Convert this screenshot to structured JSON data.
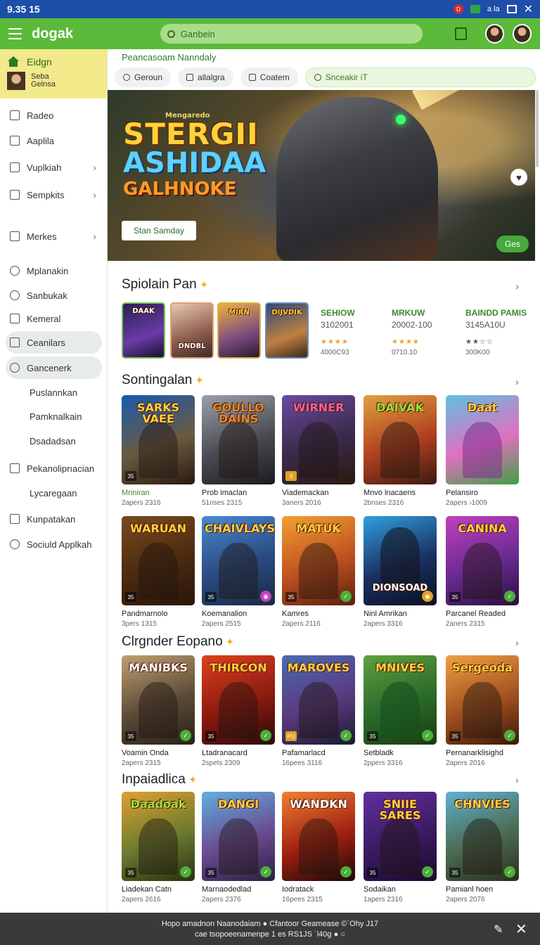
{
  "status": {
    "time": "9.35 15",
    "tray_text": "a la"
  },
  "appbar": {
    "brand": "dogak",
    "search_placeholder": "Ganbein"
  },
  "sidebar": {
    "home_label": "Eidgn",
    "user_name_1": "Seba",
    "user_name_2": "Gelnsa",
    "items": [
      {
        "label": "Radeo",
        "chev": ""
      },
      {
        "label": "Aaplila",
        "chev": ""
      },
      {
        "label": "Vuplkiah",
        "chev": "›"
      },
      {
        "label": "Sempkits",
        "chev": "›"
      },
      {
        "label": "Merkes",
        "chev": "›"
      },
      {
        "label": "Mplanakin",
        "chev": ""
      },
      {
        "label": "Sanbukak",
        "chev": ""
      },
      {
        "label": "Kemeral",
        "chev": ""
      },
      {
        "label": "Ceanilars",
        "chev": ""
      },
      {
        "label": "Gancenerk",
        "chev": ""
      },
      {
        "label": "Puslannkan",
        "chev": ""
      },
      {
        "label": "Pamknalkain",
        "chev": ""
      },
      {
        "label": "Dsadadsan",
        "chev": ""
      },
      {
        "label": "Pekanoliprıacian",
        "chev": ""
      },
      {
        "label": "Lycaregaan",
        "chev": ""
      },
      {
        "label": "Kunpatakan",
        "chev": ""
      },
      {
        "label": "Sociuld Applkah",
        "chev": ""
      }
    ]
  },
  "main": {
    "breadcrumb": "Peancasoam Nanndaly",
    "chips": [
      "Geroun",
      "allalgra",
      "Coatem"
    ],
    "chip_search": "Snceakir iT",
    "hero": {
      "small": "Mengaredo",
      "line1": "STERGII",
      "line2": "ASHIDAA",
      "line3": "GALHNOKE",
      "button": "Stan Samday",
      "tag": "Ges",
      "fav": "♥"
    },
    "featured": {
      "title": "Spiolain Pan",
      "covers": [
        "DAAK",
        "DNDBL",
        "MIRN",
        "DIJVDIK"
      ],
      "columns": [
        {
          "name": "SEHIOW",
          "sub": "3102001",
          "stars": "★★★★",
          "count": "4000C93"
        },
        {
          "name": "MRKUW",
          "sub": "20002-100",
          "stars": "★★★★",
          "count": "0710.10"
        },
        {
          "name": "BAINDD PAMIS",
          "sub": "3145A10U",
          "stars": "★★☆☆",
          "count": "300K00"
        }
      ]
    },
    "sections": [
      {
        "title": "Sontingalan",
        "cards": [
          {
            "cover": "SARKS VAEE",
            "title": "Mriniran",
            "sub": "2apers 2316"
          },
          {
            "cover": "GOULLO DAINS",
            "title": "Prob imaclan",
            "sub": "51nses 2315"
          },
          {
            "cover": "WIRNER",
            "title": "Viademackan",
            "sub": "3aners 2016"
          },
          {
            "cover": "DAIVAK",
            "title": "Mnvo lnacaens",
            "sub": "2bnses 2316"
          },
          {
            "cover": "Daat",
            "title": "Pelansiro",
            "sub": "2apers ›1009"
          }
        ]
      },
      {
        "title": "",
        "cards": [
          {
            "cover": "WARUAN",
            "title": "Pandmarnolo",
            "sub": "3pers 1315"
          },
          {
            "cover": "CHAIVLAYS",
            "title": "Koemanalion",
            "sub": "2apers 2515"
          },
          {
            "cover": "MATUK",
            "title": "Kamres",
            "sub": "2apers 2116"
          },
          {
            "cover": "DIONSOAD",
            "title": "Ninl Amrikan",
            "sub": "2apers 3316"
          },
          {
            "cover": "CANINA",
            "title": "Parcanel Readed",
            "sub": "2aners 2315"
          }
        ]
      },
      {
        "title": "Clrgnder Eopano",
        "cards": [
          {
            "cover": "MANIBKS",
            "title": "Voamin Onda",
            "sub": "2apers 2315"
          },
          {
            "cover": "THIRCON",
            "title": "Ltadranacard",
            "sub": "2spets 2309"
          },
          {
            "cover": "MAROVES",
            "title": "Pafamarlacd",
            "sub": "16pees 3116"
          },
          {
            "cover": "MNIVES",
            "title": "Setbladk",
            "sub": "2ppers 3316"
          },
          {
            "cover": "Sergeoda",
            "title": "Pernanarklisighd",
            "sub": "2apers 2016"
          }
        ]
      },
      {
        "title": "Inpaiadlica",
        "cards": [
          {
            "cover": "Daadoak",
            "title": "Liadekan Catn",
            "sub": "2apers 2616"
          },
          {
            "cover": "DANGI",
            "title": "Marnaodedlad",
            "sub": "2apers 2376"
          },
          {
            "cover": "WANDKN",
            "title": "Iodratack",
            "sub": "16pees 2315"
          },
          {
            "cover": "SNIIE SARES",
            "title": "Sodaikan",
            "sub": "1apers 2316"
          },
          {
            "cover": "CHNVIES",
            "title": "Pamianl hoen",
            "sub": "2apers 2076"
          }
        ]
      }
    ]
  },
  "bottombar": {
    "line1": "Hopo amadnon Naanodaiam ● Cfantoor Geamease ©`Ohy J17",
    "line2": "cae tsopoeenamenpe 1 es RS1JS ˙l40g ● ○"
  },
  "colors": {
    "green": "#5bba3a",
    "status_blue": "#1d4fa8",
    "home_yellow": "#f2e98a",
    "footer": "#3a3a3a"
  }
}
